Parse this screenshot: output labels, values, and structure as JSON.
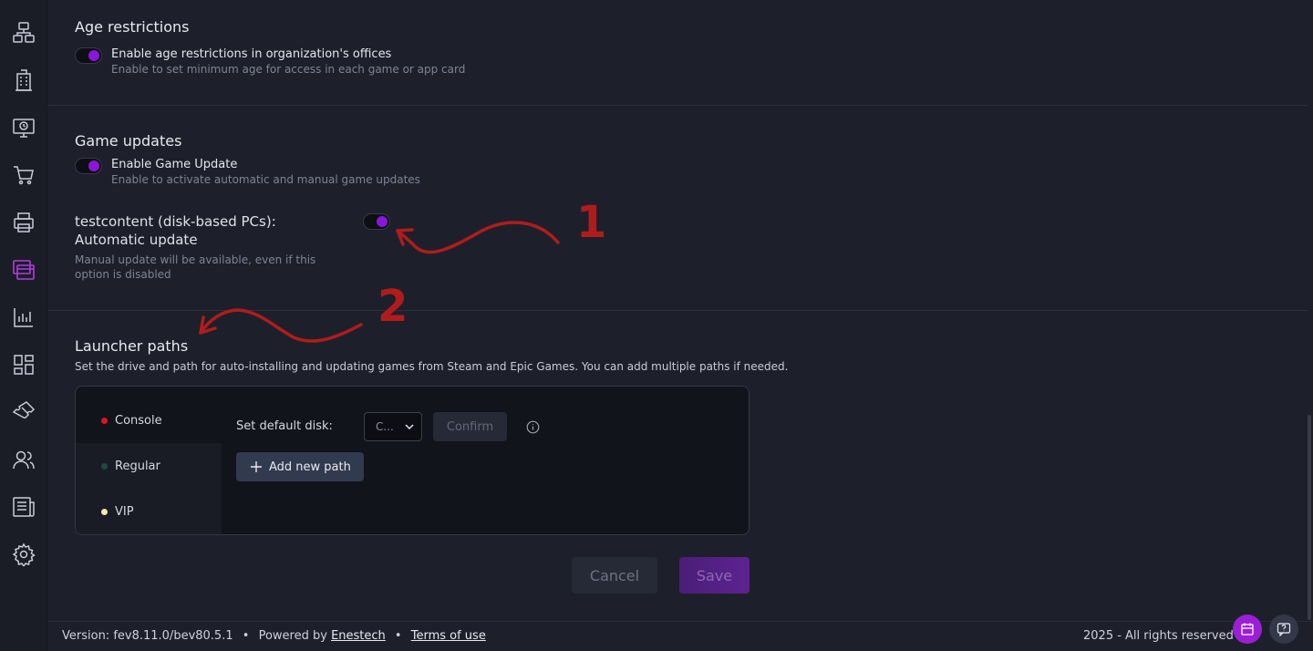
{
  "sidebar": {
    "items": [
      {
        "icon": "network-icon"
      },
      {
        "icon": "building-icon"
      },
      {
        "icon": "monitor-clock-icon"
      },
      {
        "icon": "cart-icon"
      },
      {
        "icon": "printer-icon"
      },
      {
        "icon": "windows-icon",
        "active": true
      },
      {
        "icon": "chart-icon"
      },
      {
        "icon": "dashboard-icon"
      },
      {
        "icon": "ticket-icon"
      },
      {
        "icon": "users-icon"
      },
      {
        "icon": "news-icon"
      },
      {
        "icon": "settings-icon"
      }
    ],
    "active_color": "#b23ce0"
  },
  "age": {
    "title": "Age restrictions",
    "toggle_label": "Enable age restrictions in organization's offices",
    "toggle_desc": "Enable to set minimum age for access in each game or app card",
    "enabled": true
  },
  "updates": {
    "title": "Game updates",
    "toggle_label": "Enable Game Update",
    "toggle_desc": "Enable to activate automatic and manual game updates",
    "enabled": true,
    "auto_label_line1": "testcontent (disk-based PCs):",
    "auto_label_line2": "Automatic update",
    "auto_desc_line1": "Manual update will be available, even if this",
    "auto_desc_line2": "option is disabled",
    "auto_enabled": true
  },
  "launcher": {
    "title": "Launcher paths",
    "description": "Set the drive and path for auto-installing and updating games from Steam and Epic Games. You can add multiple paths if needed.",
    "tabs": [
      {
        "label": "Console",
        "color": "#e0141c"
      },
      {
        "label": "Regular",
        "color": "#1e4a40"
      },
      {
        "label": "VIP",
        "color": "#f2eab0"
      }
    ],
    "default_disk_label": "Set default disk:",
    "disk_value": "C...",
    "confirm_label": "Confirm",
    "add_path_label": "Add new path"
  },
  "actions": {
    "cancel_label": "Cancel",
    "save_label": "Save"
  },
  "annotations": {
    "one": "1",
    "two": "2",
    "color": "#b01c1c"
  },
  "footer": {
    "version": "Version: fev8.11.0/bev80.5.1",
    "separator": "•",
    "powered_by": "Powered by",
    "company": "Enestech",
    "terms": "Terms of use",
    "rights": "2025 - All rights reserved"
  },
  "accent": "#8a16d8"
}
